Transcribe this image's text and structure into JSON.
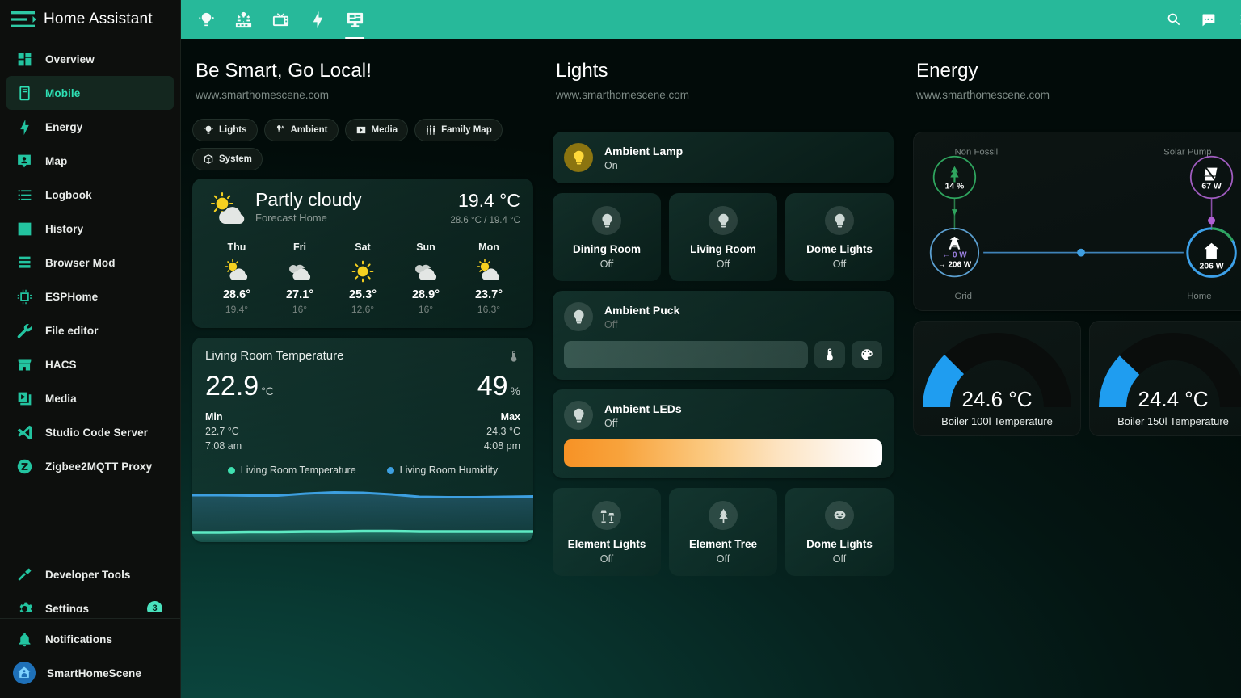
{
  "sidebar": {
    "title": "Home Assistant",
    "burger_icon": "menu-collapse-icon",
    "items": [
      {
        "label": "Overview",
        "icon": "view-dashboard-icon",
        "active": false
      },
      {
        "label": "Mobile",
        "icon": "cellphone-icon",
        "active": true
      },
      {
        "label": "Energy",
        "icon": "lightning-bolt-icon",
        "active": false
      },
      {
        "label": "Map",
        "icon": "map-marker-account-icon",
        "active": false
      },
      {
        "label": "Logbook",
        "icon": "format-list-bulleted-icon",
        "active": false
      },
      {
        "label": "History",
        "icon": "chart-box-icon",
        "active": false
      },
      {
        "label": "Browser Mod",
        "icon": "server-icon",
        "active": false
      },
      {
        "label": "ESPHome",
        "icon": "chip-icon",
        "active": false
      },
      {
        "label": "File editor",
        "icon": "wrench-icon",
        "active": false
      },
      {
        "label": "HACS",
        "icon": "storefront-icon",
        "active": false
      },
      {
        "label": "Media",
        "icon": "play-box-multiple-icon",
        "active": false
      },
      {
        "label": "Studio Code Server",
        "icon": "vscode-icon",
        "active": false
      },
      {
        "label": "Zigbee2MQTT Proxy",
        "icon": "zigbee-icon",
        "active": false
      }
    ],
    "bottom_items": [
      {
        "label": "Developer Tools",
        "icon": "hammer-icon",
        "badge": ""
      },
      {
        "label": "Settings",
        "icon": "cog-icon",
        "badge": "3"
      }
    ],
    "footer_items": [
      {
        "label": "Notifications",
        "icon": "bell-icon"
      },
      {
        "label": "SmartHomeScene",
        "icon": "user-avatar-icon"
      }
    ]
  },
  "topbar": {
    "tabs": [
      {
        "name": "lights-tab",
        "icon": "ceiling-light-icon",
        "active": false
      },
      {
        "name": "ac-tab",
        "icon": "air-conditioner-icon",
        "active": false
      },
      {
        "name": "media-tab",
        "icon": "television-classic-icon",
        "active": false
      },
      {
        "name": "energy-tab",
        "icon": "lightning-bolt-icon",
        "active": false
      },
      {
        "name": "dashboard-tab",
        "icon": "monitor-dashboard-icon",
        "active": true
      }
    ],
    "actions": [
      {
        "name": "search-button",
        "icon": "search-icon"
      },
      {
        "name": "assist-button",
        "icon": "chat-bubble-icon"
      },
      {
        "name": "overflow-menu-button",
        "icon": "dots-vertical-icon"
      }
    ]
  },
  "columns": {
    "left": {
      "title": "Be Smart, Go Local!",
      "subtitle": "www.smarthomescene.com"
    },
    "middle": {
      "title": "Lights",
      "subtitle": "www.smarthomescene.com"
    },
    "right": {
      "title": "Energy",
      "subtitle": "www.smarthomescene.com"
    }
  },
  "chips": [
    {
      "label": "Lights",
      "icon": "ceiling-light-icon"
    },
    {
      "label": "Ambient",
      "icon": "ambient-light-icon"
    },
    {
      "label": "Media",
      "icon": "play-box-icon"
    },
    {
      "label": "Family Map",
      "icon": "account-group-icon"
    },
    {
      "label": "System",
      "icon": "package-variant-icon"
    }
  ],
  "weather": {
    "condition": "Partly cloudy",
    "location": "Forecast Home",
    "temperature": "19.4 °C",
    "range": "28.6 °C / 19.4 °C",
    "icon": "partly-cloudy-icon",
    "forecast": [
      {
        "day": "Thu",
        "icon": "partly-cloudy-icon",
        "high": "28.6°",
        "low": "19.4°"
      },
      {
        "day": "Fri",
        "icon": "cloudy-icon",
        "high": "27.1°",
        "low": "16°"
      },
      {
        "day": "Sat",
        "icon": "sunny-icon",
        "high": "25.3°",
        "low": "12.6°"
      },
      {
        "day": "Sun",
        "icon": "cloudy-icon",
        "high": "28.9°",
        "low": "16°"
      },
      {
        "day": "Mon",
        "icon": "partly-cloudy-icon",
        "high": "23.7°",
        "low": "16.3°"
      }
    ]
  },
  "living_room": {
    "title": "Living Room Temperature",
    "thermo_icon": "thermometer-icon",
    "temperature": "22.9",
    "temperature_unit": "°C",
    "humidity": "49",
    "humidity_unit": "%",
    "min_label": "Min",
    "min_value": "22.7 °C",
    "min_time": "7:08 am",
    "max_label": "Max",
    "max_value": "24.3 °C",
    "max_time": "4:08 pm",
    "legend": [
      {
        "label": "Living Room Temperature",
        "color": "#3fe0b0"
      },
      {
        "label": "Living Room Humidity",
        "color": "#3d9fe0"
      }
    ]
  },
  "chart_data": {
    "type": "line",
    "title": "Living Room Temperature",
    "xlabel": "",
    "ylabel": "",
    "grid": false,
    "legend_position": "top",
    "series": [
      {
        "name": "Living Room Humidity",
        "color": "#3d9fe0",
        "unit": "%",
        "values": [
          49.2,
          49.2,
          49.1,
          49.1,
          49.3,
          49.6,
          49.7,
          49.5,
          49.0,
          48.9,
          48.9,
          48.9,
          49.0
        ]
      },
      {
        "name": "Living Room Temperature",
        "color": "#3fe0b0",
        "unit": "°C",
        "values": [
          22.7,
          22.7,
          22.8,
          22.8,
          22.9,
          22.9,
          23.0,
          23.0,
          22.9,
          22.9,
          22.9,
          22.9,
          22.9
        ]
      }
    ]
  },
  "lights": {
    "ambient_lamp": {
      "name": "Ambient Lamp",
      "state": "On",
      "icon": "lightbulb-icon",
      "on": true
    },
    "quick_tiles": [
      {
        "name": "Dining Room",
        "state": "Off",
        "icon": "lightbulb-icon"
      },
      {
        "name": "Living Room",
        "state": "Off",
        "icon": "lightbulb-icon"
      },
      {
        "name": "Dome Lights",
        "state": "Off",
        "icon": "lightbulb-icon"
      }
    ],
    "ambient_puck": {
      "name": "Ambient Puck",
      "state": "Off",
      "icon": "lightbulb-icon",
      "brightness_slider": "brightness-slider",
      "buttons": [
        {
          "name": "color-temp-button",
          "icon": "thermometer-icon"
        },
        {
          "name": "color-picker-button",
          "icon": "palette-icon"
        }
      ]
    },
    "ambient_leds": {
      "name": "Ambient LEDs",
      "state": "Off",
      "icon": "lightbulb-icon",
      "gradient_slider": "color-temp-slider"
    },
    "bottom_tiles": [
      {
        "name": "Element Lights",
        "state": "Off",
        "icon": "floor-lamp-icon"
      },
      {
        "name": "Element Tree",
        "state": "Off",
        "icon": "pine-tree-icon"
      },
      {
        "name": "Dome Lights",
        "state": "Off",
        "icon": "emoticon-icon"
      }
    ]
  },
  "energy": {
    "flow": {
      "non_fossil": {
        "label": "Non Fossil",
        "value": "14 %",
        "icon": "leaf-pine-icon",
        "color": "#2fa55e"
      },
      "solar_pump": {
        "label": "Solar Pump",
        "value": "67 W",
        "icon": "solar-panel-icon",
        "color": "#a05cc0"
      },
      "grid": {
        "label": "Grid",
        "in_value": "← 0 W",
        "out_value": "→ 206 W",
        "icon": "transmission-tower-icon",
        "color": "#4f9fd8"
      },
      "home": {
        "label": "Home",
        "value": "206 W",
        "icon": "home-icon",
        "color": "#3da0e8"
      }
    },
    "gauges": [
      {
        "label": "Boiler 100l Temperature",
        "value": "24.6 °C",
        "percent": 17,
        "color": "#1f9df0"
      },
      {
        "label": "Boiler 150l Temperature",
        "value": "24.4 °C",
        "percent": 16,
        "color": "#1f9df0"
      }
    ]
  }
}
